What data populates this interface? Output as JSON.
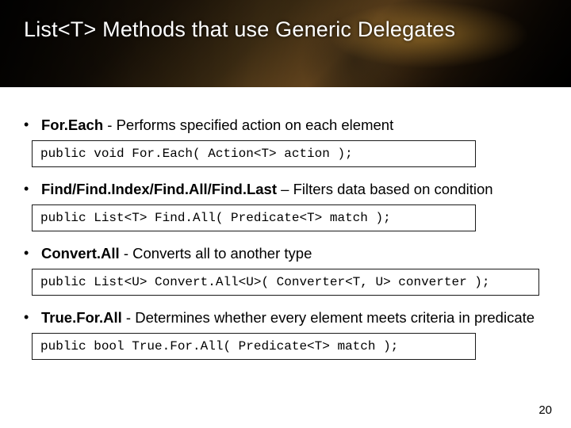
{
  "title": "List<T> Methods that use Generic Delegates",
  "bullets": [
    {
      "name": "For.Each",
      "desc": " - Performs specified action on each element"
    },
    {
      "name": "Find/Find.Index/Find.All/Find.Last",
      "desc": " – Filters data based on condition"
    },
    {
      "name": "Convert.All",
      "desc": " - Converts all to another type"
    },
    {
      "name": "True.For.All",
      "desc": " - Determines whether every element meets criteria in predicate"
    }
  ],
  "codes": [
    "public void For.Each( Action<T> action );",
    "public List<T> Find.All( Predicate<T> match );",
    "public List<U> Convert.All<U>( Converter<T, U> converter );",
    "public bool True.For.All( Predicate<T> match );"
  ],
  "page_number": "20"
}
